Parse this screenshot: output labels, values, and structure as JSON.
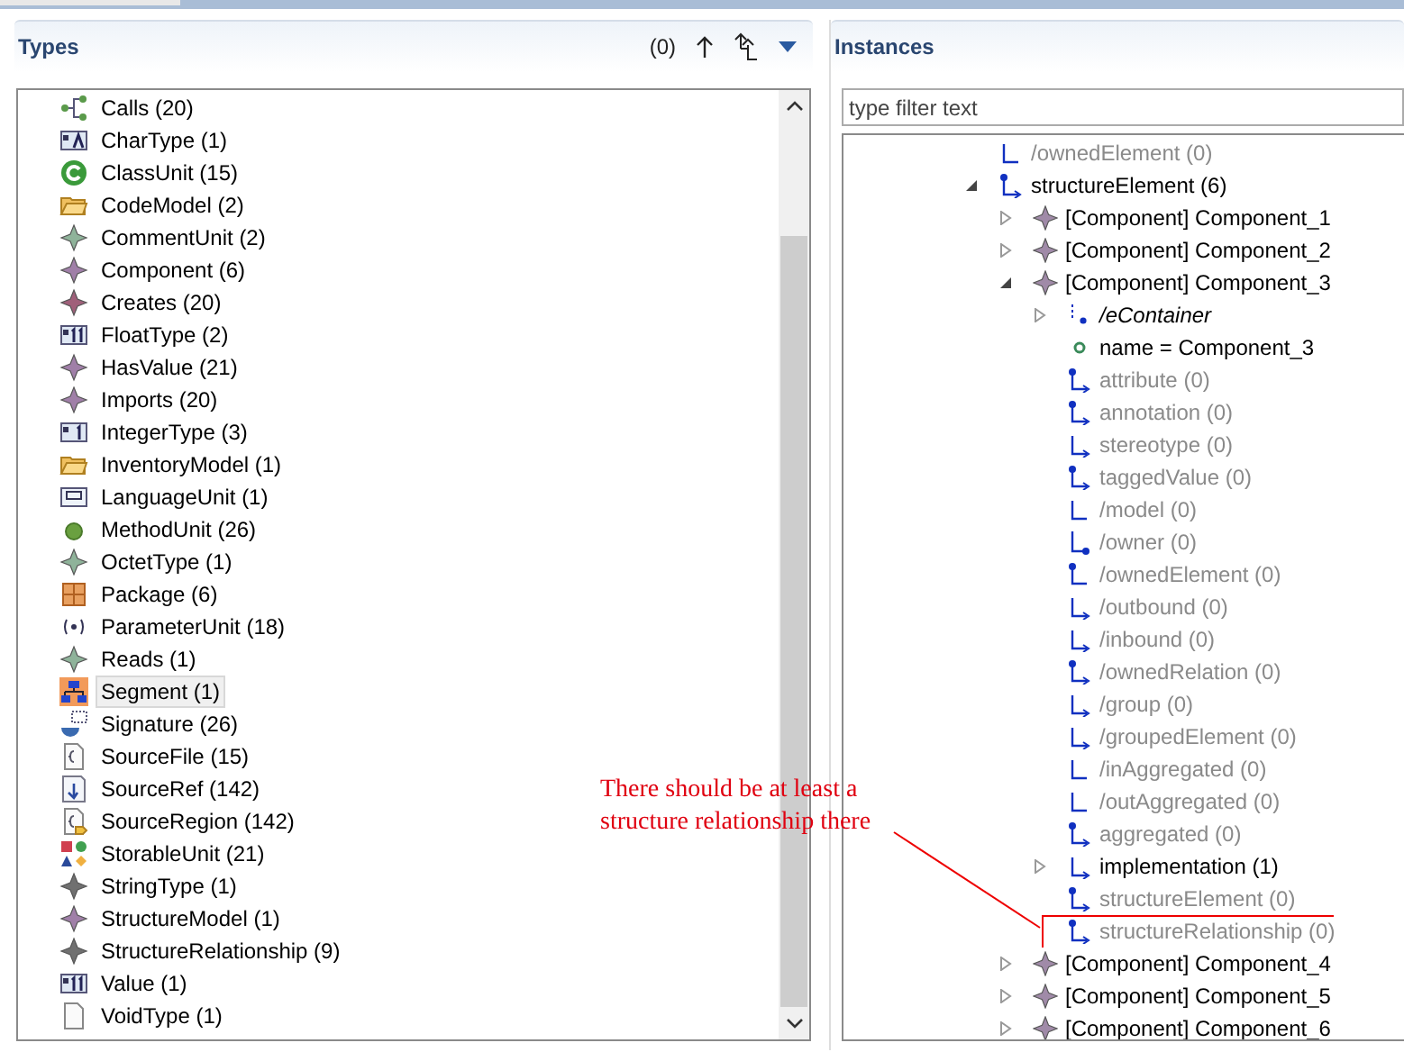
{
  "types_panel": {
    "title": "Types",
    "count": "(0)",
    "items": [
      {
        "label": "Calls (20)",
        "kind": "calls",
        "selected": false
      },
      {
        "label": "CharType (1)",
        "kind": "chartype",
        "selected": false
      },
      {
        "label": "ClassUnit (15)",
        "kind": "classunit",
        "selected": false
      },
      {
        "label": "CodeModel (2)",
        "kind": "codemodel",
        "selected": false
      },
      {
        "label": "CommentUnit (2)",
        "kind": "greendiamond",
        "selected": false
      },
      {
        "label": "Component (6)",
        "kind": "purplediamond",
        "selected": false
      },
      {
        "label": "Creates (20)",
        "kind": "reddiamond",
        "selected": false
      },
      {
        "label": "FloatType (2)",
        "kind": "float",
        "selected": false
      },
      {
        "label": "HasValue (21)",
        "kind": "purplediamond",
        "selected": false
      },
      {
        "label": "Imports (20)",
        "kind": "purplediamond",
        "selected": false
      },
      {
        "label": "IntegerType (3)",
        "kind": "integer",
        "selected": false
      },
      {
        "label": "InventoryModel (1)",
        "kind": "folder",
        "selected": false
      },
      {
        "label": "LanguageUnit (1)",
        "kind": "language",
        "selected": false
      },
      {
        "label": "MethodUnit (26)",
        "kind": "method",
        "selected": false
      },
      {
        "label": "OctetType (1)",
        "kind": "greendiamond",
        "selected": false
      },
      {
        "label": "Package (6)",
        "kind": "package",
        "selected": false
      },
      {
        "label": "ParameterUnit (18)",
        "kind": "parameter",
        "selected": false
      },
      {
        "label": "Reads (1)",
        "kind": "greendiamond",
        "selected": false
      },
      {
        "label": "Segment (1)",
        "kind": "segment",
        "selected": true
      },
      {
        "label": "Signature (26)",
        "kind": "signature",
        "selected": false
      },
      {
        "label": "SourceFile (15)",
        "kind": "sourcefile",
        "selected": false
      },
      {
        "label": "SourceRef (142)",
        "kind": "sourceref",
        "selected": false
      },
      {
        "label": "SourceRegion (142)",
        "kind": "sourceregion",
        "selected": false
      },
      {
        "label": "StorableUnit (21)",
        "kind": "storable",
        "selected": false
      },
      {
        "label": "StringType (1)",
        "kind": "greydiamond",
        "selected": false
      },
      {
        "label": "StructureModel (1)",
        "kind": "purplediamond",
        "selected": false
      },
      {
        "label": "StructureRelationship (9)",
        "kind": "greydiamond",
        "selected": false
      },
      {
        "label": "Value (1)",
        "kind": "float",
        "selected": false
      },
      {
        "label": "VoidType (1)",
        "kind": "void",
        "selected": false
      }
    ]
  },
  "instances_panel": {
    "title": "Instances",
    "filter": {
      "placeholder": "type filter text"
    },
    "tree": [
      {
        "label": "/ownedElement (0)",
        "kind": "plainlink",
        "disabled": true,
        "italic": false
      },
      {
        "label": "structureElement (6)",
        "kind": "containment",
        "expanded": true,
        "disabled": false,
        "italic": false,
        "children": [
          {
            "label": "[Component] Component_1",
            "kind": "component",
            "expanded": false,
            "disabled": false,
            "italic": false
          },
          {
            "label": "[Component] Component_2",
            "kind": "component",
            "expanded": false,
            "disabled": false,
            "italic": false
          },
          {
            "label": "[Component] Component_3",
            "kind": "component",
            "expanded": true,
            "disabled": false,
            "italic": false,
            "children": [
              {
                "label": "/eContainer",
                "kind": "container",
                "expanded": false,
                "disabled": false,
                "italic": true
              },
              {
                "label": "name = Component_3",
                "kind": "attribute",
                "disabled": false,
                "italic": false
              },
              {
                "label": "attribute (0)",
                "kind": "containment",
                "disabled": true,
                "italic": false
              },
              {
                "label": "annotation (0)",
                "kind": "containment",
                "disabled": true,
                "italic": false
              },
              {
                "label": "stereotype (0)",
                "kind": "link",
                "disabled": true,
                "italic": false
              },
              {
                "label": "taggedValue (0)",
                "kind": "containment",
                "disabled": true,
                "italic": false
              },
              {
                "label": "/model (0)",
                "kind": "plainlink",
                "disabled": true,
                "italic": false
              },
              {
                "label": "/owner (0)",
                "kind": "ownerlink",
                "disabled": true,
                "italic": false
              },
              {
                "label": "/ownedElement (0)",
                "kind": "ownedlink",
                "disabled": true,
                "italic": false
              },
              {
                "label": "/outbound (0)",
                "kind": "link",
                "disabled": true,
                "italic": false
              },
              {
                "label": "/inbound (0)",
                "kind": "link",
                "disabled": true,
                "italic": false
              },
              {
                "label": "/ownedRelation (0)",
                "kind": "containment",
                "disabled": true,
                "italic": false
              },
              {
                "label": "/group (0)",
                "kind": "link",
                "disabled": true,
                "italic": false
              },
              {
                "label": "/groupedElement (0)",
                "kind": "link",
                "disabled": true,
                "italic": false
              },
              {
                "label": "/inAggregated (0)",
                "kind": "plainlink",
                "disabled": true,
                "italic": false
              },
              {
                "label": "/outAggregated (0)",
                "kind": "plainlink",
                "disabled": true,
                "italic": false
              },
              {
                "label": "aggregated (0)",
                "kind": "containment",
                "disabled": true,
                "italic": false
              },
              {
                "label": "implementation (1)",
                "kind": "link",
                "expanded": false,
                "disabled": false,
                "italic": false
              },
              {
                "label": "structureElement (0)",
                "kind": "containment",
                "disabled": true,
                "italic": false
              },
              {
                "label": "structureRelationship (0)",
                "kind": "containment",
                "disabled": true,
                "italic": false
              }
            ]
          },
          {
            "label": "[Component] Component_4",
            "kind": "component",
            "expanded": false,
            "disabled": false,
            "italic": false
          },
          {
            "label": "[Component] Component_5",
            "kind": "component",
            "expanded": false,
            "disabled": false,
            "italic": false
          },
          {
            "label": "[Component] Component_6",
            "kind": "component",
            "expanded": false,
            "disabled": false,
            "italic": false
          }
        ]
      }
    ]
  },
  "annotation": {
    "text": "There should be at least a structure relationship there"
  }
}
